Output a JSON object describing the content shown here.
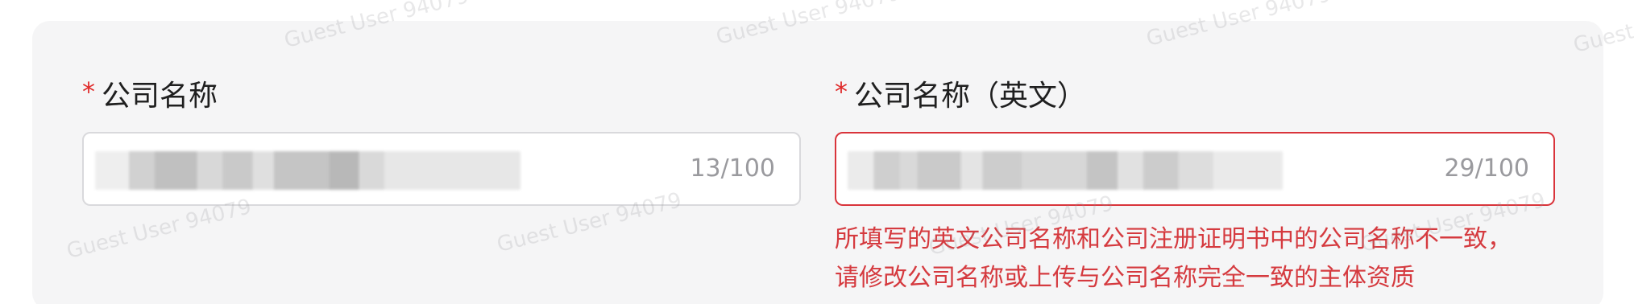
{
  "form": {
    "company_name": {
      "required_mark": "*",
      "label": "公司名称",
      "counter": "13/100"
    },
    "company_name_en": {
      "required_mark": "*",
      "label": "公司名称（英文）",
      "counter": "29/100",
      "error_line1": "所填写的英文公司名称和公司注册证明书中的公司名称不一致，",
      "error_line2": "请修改公司名称或上传与公司名称完全一致的主体资质"
    }
  },
  "watermark": {
    "text": "Guest User 94079"
  },
  "colors": {
    "required": "#e02b2b",
    "error": "#d9343b",
    "card_background": "#f5f5f6"
  }
}
